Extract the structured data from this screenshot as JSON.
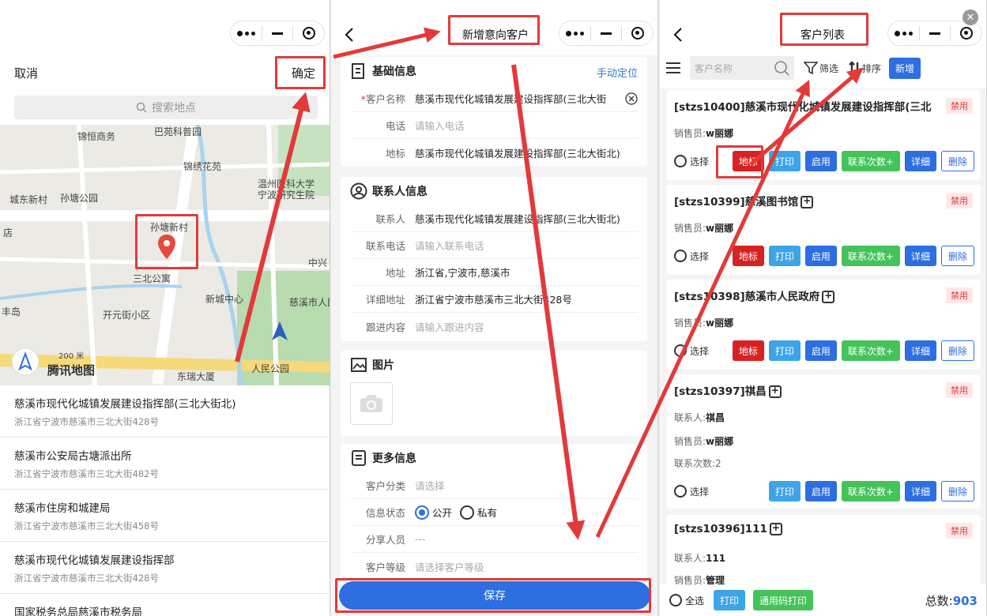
{
  "capsule": {
    "more": "more-icon",
    "minimize": "minimize-icon",
    "close": "target-icon"
  },
  "panel1": {
    "cancel": "取消",
    "confirm": "确定",
    "search_placeholder": "搜索地点",
    "map_labels": [
      "锦恒商务",
      "巴苑科普园",
      "锦绣花苑",
      "温州医科大学",
      "宁波研究生院",
      "城东新村",
      "孙塘公园",
      "孙塘新村",
      "三北公寓",
      "中兴",
      "新城中心",
      "慈溪市人民",
      "开元街小区",
      "丰岛",
      "店",
      "人民公园",
      "东瑞大厦",
      "腾讯地图",
      "200 米"
    ],
    "pois": [
      {
        "name": "慈溪市现代化城镇发展建设指挥部(三北大街北)",
        "addr": "浙江省宁波市慈溪市三北大街428号"
      },
      {
        "name": "慈溪市公安局古塘派出所",
        "addr": "浙江省宁波市慈溪市三北大街482号"
      },
      {
        "name": "慈溪市住房和城建局",
        "addr": "浙江省宁波市慈溪市三北大街458号"
      },
      {
        "name": "慈溪市现代化城镇发展建设指挥部",
        "addr": "浙江省宁波市慈溪市三北大街428号"
      },
      {
        "name": "国家税务总局慈溪市税务局",
        "addr": ""
      }
    ]
  },
  "panel2": {
    "title": "新增意向客户",
    "basic": {
      "title": "基础信息",
      "manual_locate": "手动定位",
      "name_label": "客户名称",
      "name_value": "慈溪市现代化城镇发展建设指挥部(三北大街",
      "phone_label": "电话",
      "phone_ph": "请输入电话",
      "landmark_label": "地标",
      "landmark_value": "慈溪市现代化城镇发展建设指挥部(三北大街北)"
    },
    "contact": {
      "title": "联系人信息",
      "person_label": "联系人",
      "person_value": "慈溪市现代化城镇发展建设指挥部(三北大街北)",
      "phone_label": "联系电话",
      "phone_ph": "请输入联系电话",
      "addr_label": "地址",
      "addr_value": "浙江省,宁波市,慈溪市",
      "detail_label": "详细地址",
      "detail_value": "浙江省宁波市慈溪市三北大街428号",
      "follow_label": "跟进内容",
      "follow_ph": "请输入跟进内容"
    },
    "image": {
      "title": "图片"
    },
    "more": {
      "title": "更多信息",
      "category_label": "客户分类",
      "category_ph": "请选择",
      "status_label": "信息状态",
      "public": "公开",
      "private": "私有",
      "share_label": "分享人员",
      "share_value": "---",
      "level_label": "客户等级",
      "level_ph": "请选择客户等级"
    },
    "save": "保存"
  },
  "panel3": {
    "title": "客户列表",
    "search_ph": "客户名称",
    "filter": "筛选",
    "sort": "排序",
    "new": "新增",
    "labels": {
      "select": "选择",
      "disabled": "禁用",
      "landmark": "地标",
      "print": "打印",
      "enable": "启用",
      "contact_count": "联系次数+",
      "detail": "详细",
      "delete": "删除"
    },
    "customers": [
      {
        "name": "[stzs10400]慈溪市现代化城镇发展建设指挥部(三北",
        "sales": "w丽娜"
      },
      {
        "name": "[stzs10399]慈溪图书馆",
        "sales": "w丽娜"
      },
      {
        "name": "[stzs10398]慈溪市人民政府",
        "sales": "w丽娜"
      },
      {
        "name": "[stzs10397]祺昌",
        "contact": "祺昌",
        "sales": "w丽娜",
        "count": "联系次数:2"
      },
      {
        "name": "[stzs10396]111",
        "contact": "111",
        "sales": "管理"
      }
    ],
    "sales_label": "销售员:",
    "contact_label": "联系人:",
    "footer": {
      "select_all": "全选",
      "print": "打印",
      "generic_print": "通用码打印",
      "total_label": "总数:",
      "total": "903"
    }
  },
  "colors": {
    "accent": "#2d6ee0",
    "danger": "#d92121",
    "success": "#44c35a",
    "sky": "#3da4e8",
    "annotation": "#e23a3a"
  }
}
